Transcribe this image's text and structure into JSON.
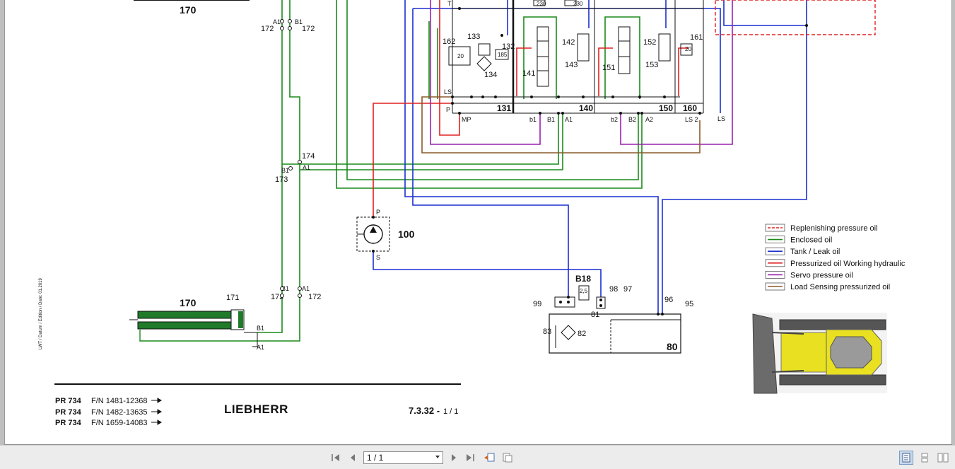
{
  "document": {
    "components": {
      "cyl_top": "170",
      "cyl_bottom": "170",
      "cyl_piston": "171",
      "hose_172": "172",
      "hose_173": "173",
      "hose_174": "174",
      "pump": "100",
      "pump_p": "P",
      "pump_s": "S",
      "sec_131": "131",
      "sec_140": "140",
      "sec_150": "150",
      "sec_160": "160",
      "c133": "133",
      "c132": "132",
      "c134": "134",
      "c162": "162",
      "c142": "142",
      "c143": "143",
      "c141": "141",
      "c152": "152",
      "c153": "153",
      "c151": "151",
      "c161": "161",
      "c230": "230",
      "sensor_b18": "B18",
      "c98": "98",
      "c97": "97",
      "c99": "99",
      "c81": "81",
      "c83": "83",
      "c82": "82",
      "c96": "96",
      "c95": "95",
      "tank": "80",
      "v20": "20",
      "v185": "185",
      "v25": "2,5",
      "v20b": "20"
    },
    "ports": {
      "A1": "A1",
      "B1": "B1",
      "A2": "A2",
      "B2": "B2",
      "b1": "b1",
      "b2": "b2",
      "MP": "MP",
      "LS": "LS",
      "LS2": "LS 2",
      "P": "P",
      "T": "T"
    },
    "legend": [
      {
        "label": "Replenishing pressure oil",
        "color": "#e02020",
        "dashed": true
      },
      {
        "label": "Enclosed oil",
        "color": "#1a8a1a",
        "dashed": false
      },
      {
        "label": "Tank / Leak oil",
        "color": "#1c2fd0",
        "dashed": false
      },
      {
        "label": "Pressurized oil Working hydraulic",
        "color": "#e02020",
        "dashed": false
      },
      {
        "label": "Servo pressure oil",
        "color": "#9b20b0",
        "dashed": false
      },
      {
        "label": "Load Sensing pressurized oil",
        "color": "#8a5a2a",
        "dashed": false
      }
    ],
    "colors": {
      "enclosed": "#1a8a1a",
      "tank": "#1c2fd0",
      "pressure": "#e02020",
      "servo": "#9b20b0",
      "ls": "#8a5a2a"
    },
    "side_text": "LWT / Datum / Edition / Date: 01.2019",
    "footer": {
      "models": [
        {
          "model": "PR 734",
          "fn": "F/N 1481-12368"
        },
        {
          "model": "PR 734",
          "fn": "F/N 1482-13635"
        },
        {
          "model": "PR 734",
          "fn": "F/N 1659-14083"
        }
      ],
      "brand": "LIEBHERR",
      "page_ref": "7.3.32 -",
      "page_ref_small": "1 / 1"
    }
  },
  "toolbar": {
    "page_value": "1 / 1",
    "icons": [
      "first-page-icon",
      "prev-page-icon",
      "next-page-icon",
      "last-page-icon",
      "go-back-icon",
      "go-forward-icon",
      "single-page-view-icon",
      "continuous-view-icon",
      "facing-view-icon"
    ]
  }
}
